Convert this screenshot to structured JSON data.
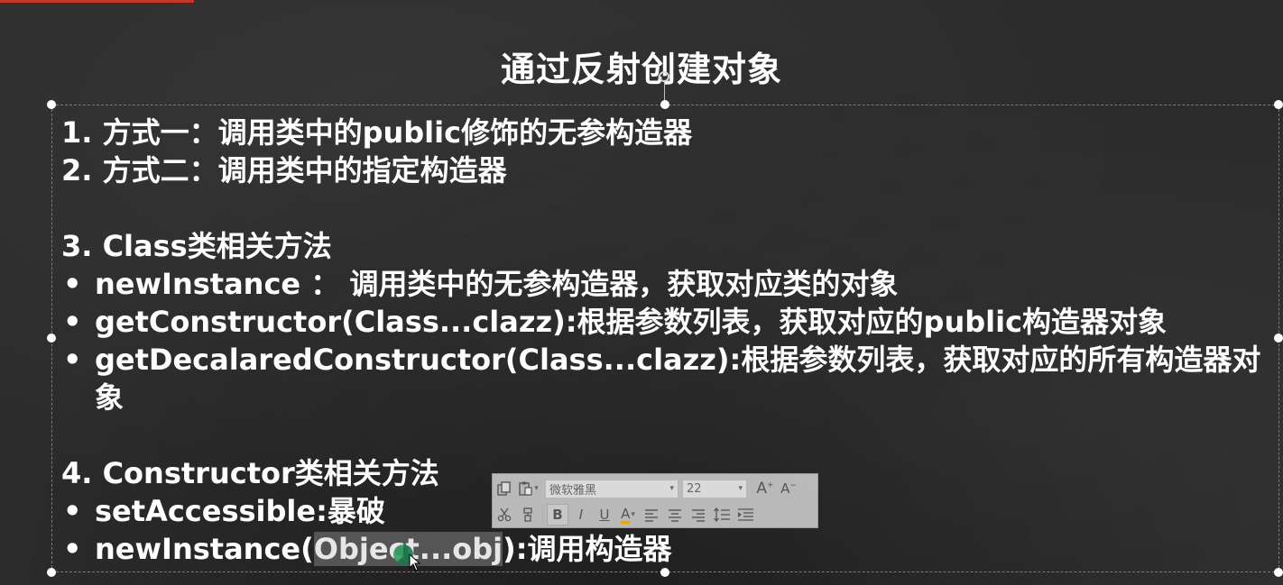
{
  "slide": {
    "title": "通过反射创建对象",
    "lines": [
      "1. 方式一：调用类中的public修饰的无参构造器",
      "2. 方式二：调用类中的指定构造器"
    ],
    "section3": {
      "heading": "3. Class类相关方法",
      "bullets": [
        "newInstance ： 调用类中的无参构造器，获取对应类的对象",
        "getConstructor(Class...clazz):根据参数列表，获取对应的public构造器对象",
        "getDecalaredConstructor(Class...clazz):根据参数列表，获取对应的所有构造器对象"
      ]
    },
    "section4": {
      "heading": "4. Constructor类相关方法",
      "bullet1": "setAccessible:暴破",
      "bullet2_prefix": "newInstance(",
      "bullet2_highlight": "Object...obj",
      "bullet2_suffix": "):调用构造器"
    },
    "bullet_symbol": "•"
  },
  "mini_toolbar": {
    "font_name": "微软雅黑",
    "font_size": "22",
    "bold_label": "B",
    "italic_label": "I",
    "underline_label": "U",
    "font_color_label": "A",
    "grow_font_label": "A",
    "shrink_font_label": "A"
  },
  "colors": {
    "background": "#2b2b2b",
    "text": "#ffffff",
    "accent": "#c0392b",
    "font_color_underline": "#e8a400"
  }
}
